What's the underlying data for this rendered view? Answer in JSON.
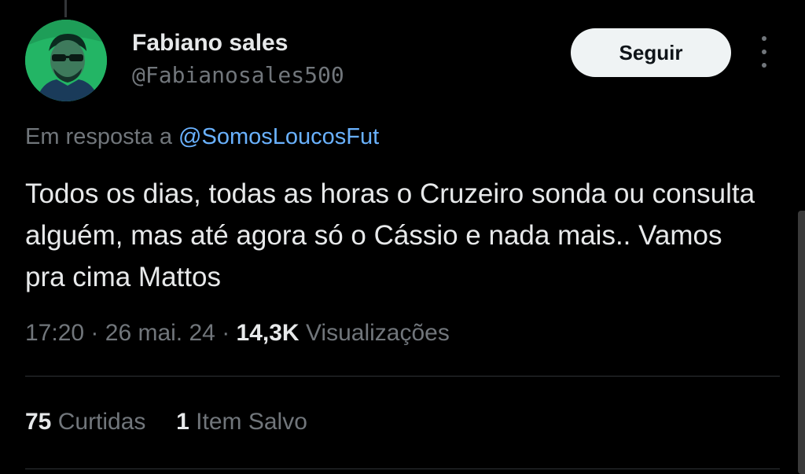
{
  "author": {
    "display_name": "Fabiano sales",
    "handle": "@Fabianosales500"
  },
  "follow_button": {
    "label": "Seguir"
  },
  "reply": {
    "prefix": "Em resposta a",
    "mention": "@SomosLoucosFut"
  },
  "tweet": {
    "text": "Todos os dias, todas as horas o Cruzeiro sonda ou consulta alguém, mas até agora só o Cássio e nada mais.. Vamos pra cima Mattos"
  },
  "meta": {
    "time": "17:20",
    "separator": "·",
    "date": "26 mai. 24",
    "views_count": "14,3K",
    "views_label": "Visualizações"
  },
  "stats": {
    "likes_count": "75",
    "likes_label": "Curtidas",
    "saves_count": "1",
    "saves_label": "Item Salvo"
  },
  "colors": {
    "background": "#000000",
    "primary_text": "#e7e9ea",
    "secondary_text": "#71767b",
    "link": "#6ab2ff",
    "follow_button_bg": "#eff3f4"
  },
  "icons": {
    "more": "more-vertical-icon",
    "avatar": "avatar"
  }
}
